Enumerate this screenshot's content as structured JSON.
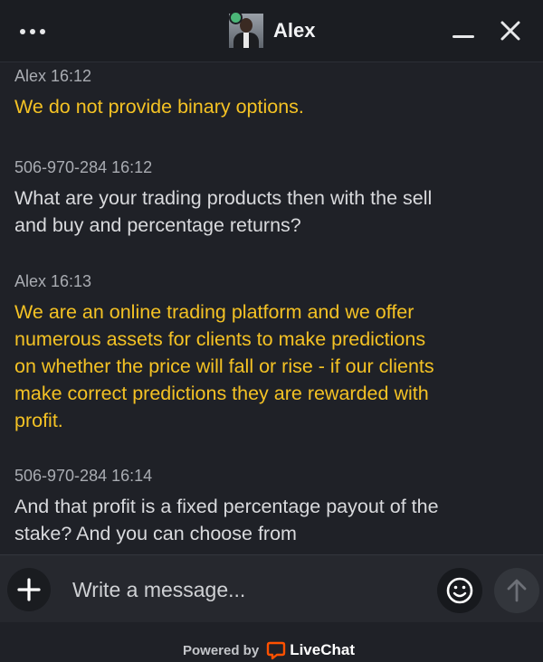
{
  "header": {
    "agent_name": "Alex"
  },
  "messages": [
    {
      "sender": "Alex",
      "time": "16:12",
      "meta": "Alex 16:12",
      "text": "We do not provide binary options.",
      "role": "agent"
    },
    {
      "sender": "506-970-284",
      "time": "16:12",
      "meta": "506-970-284 16:12",
      "text": "What are your trading products then with the sell and buy and percentage returns?",
      "role": "visitor"
    },
    {
      "sender": "Alex",
      "time": "16:13",
      "meta": "Alex 16:13",
      "text": "We are an online trading platform and we offer numerous assets for clients to make predictions on whether the price will fall or rise - if our clients make correct predictions they are rewarded with profit.",
      "role": "agent"
    },
    {
      "sender": "506-970-284",
      "time": "16:14",
      "meta": "506-970-284 16:14",
      "text": "And that profit is a fixed percentage payout of the stake? And you can choose from",
      "role": "visitor"
    }
  ],
  "composer": {
    "placeholder": "Write a message..."
  },
  "footer": {
    "powered_by": "Powered by",
    "brand": "LiveChat"
  },
  "colors": {
    "background": "#1f2127",
    "agent_text": "#f4c224",
    "visitor_text": "#d9dadd",
    "online": "#4bb678",
    "brand_accent": "#ff5100"
  },
  "icons": [
    "menu-dots-icon",
    "minimize-icon",
    "close-icon",
    "plus-icon",
    "emoji-icon",
    "send-arrow-icon",
    "livechat-logo-icon"
  ]
}
